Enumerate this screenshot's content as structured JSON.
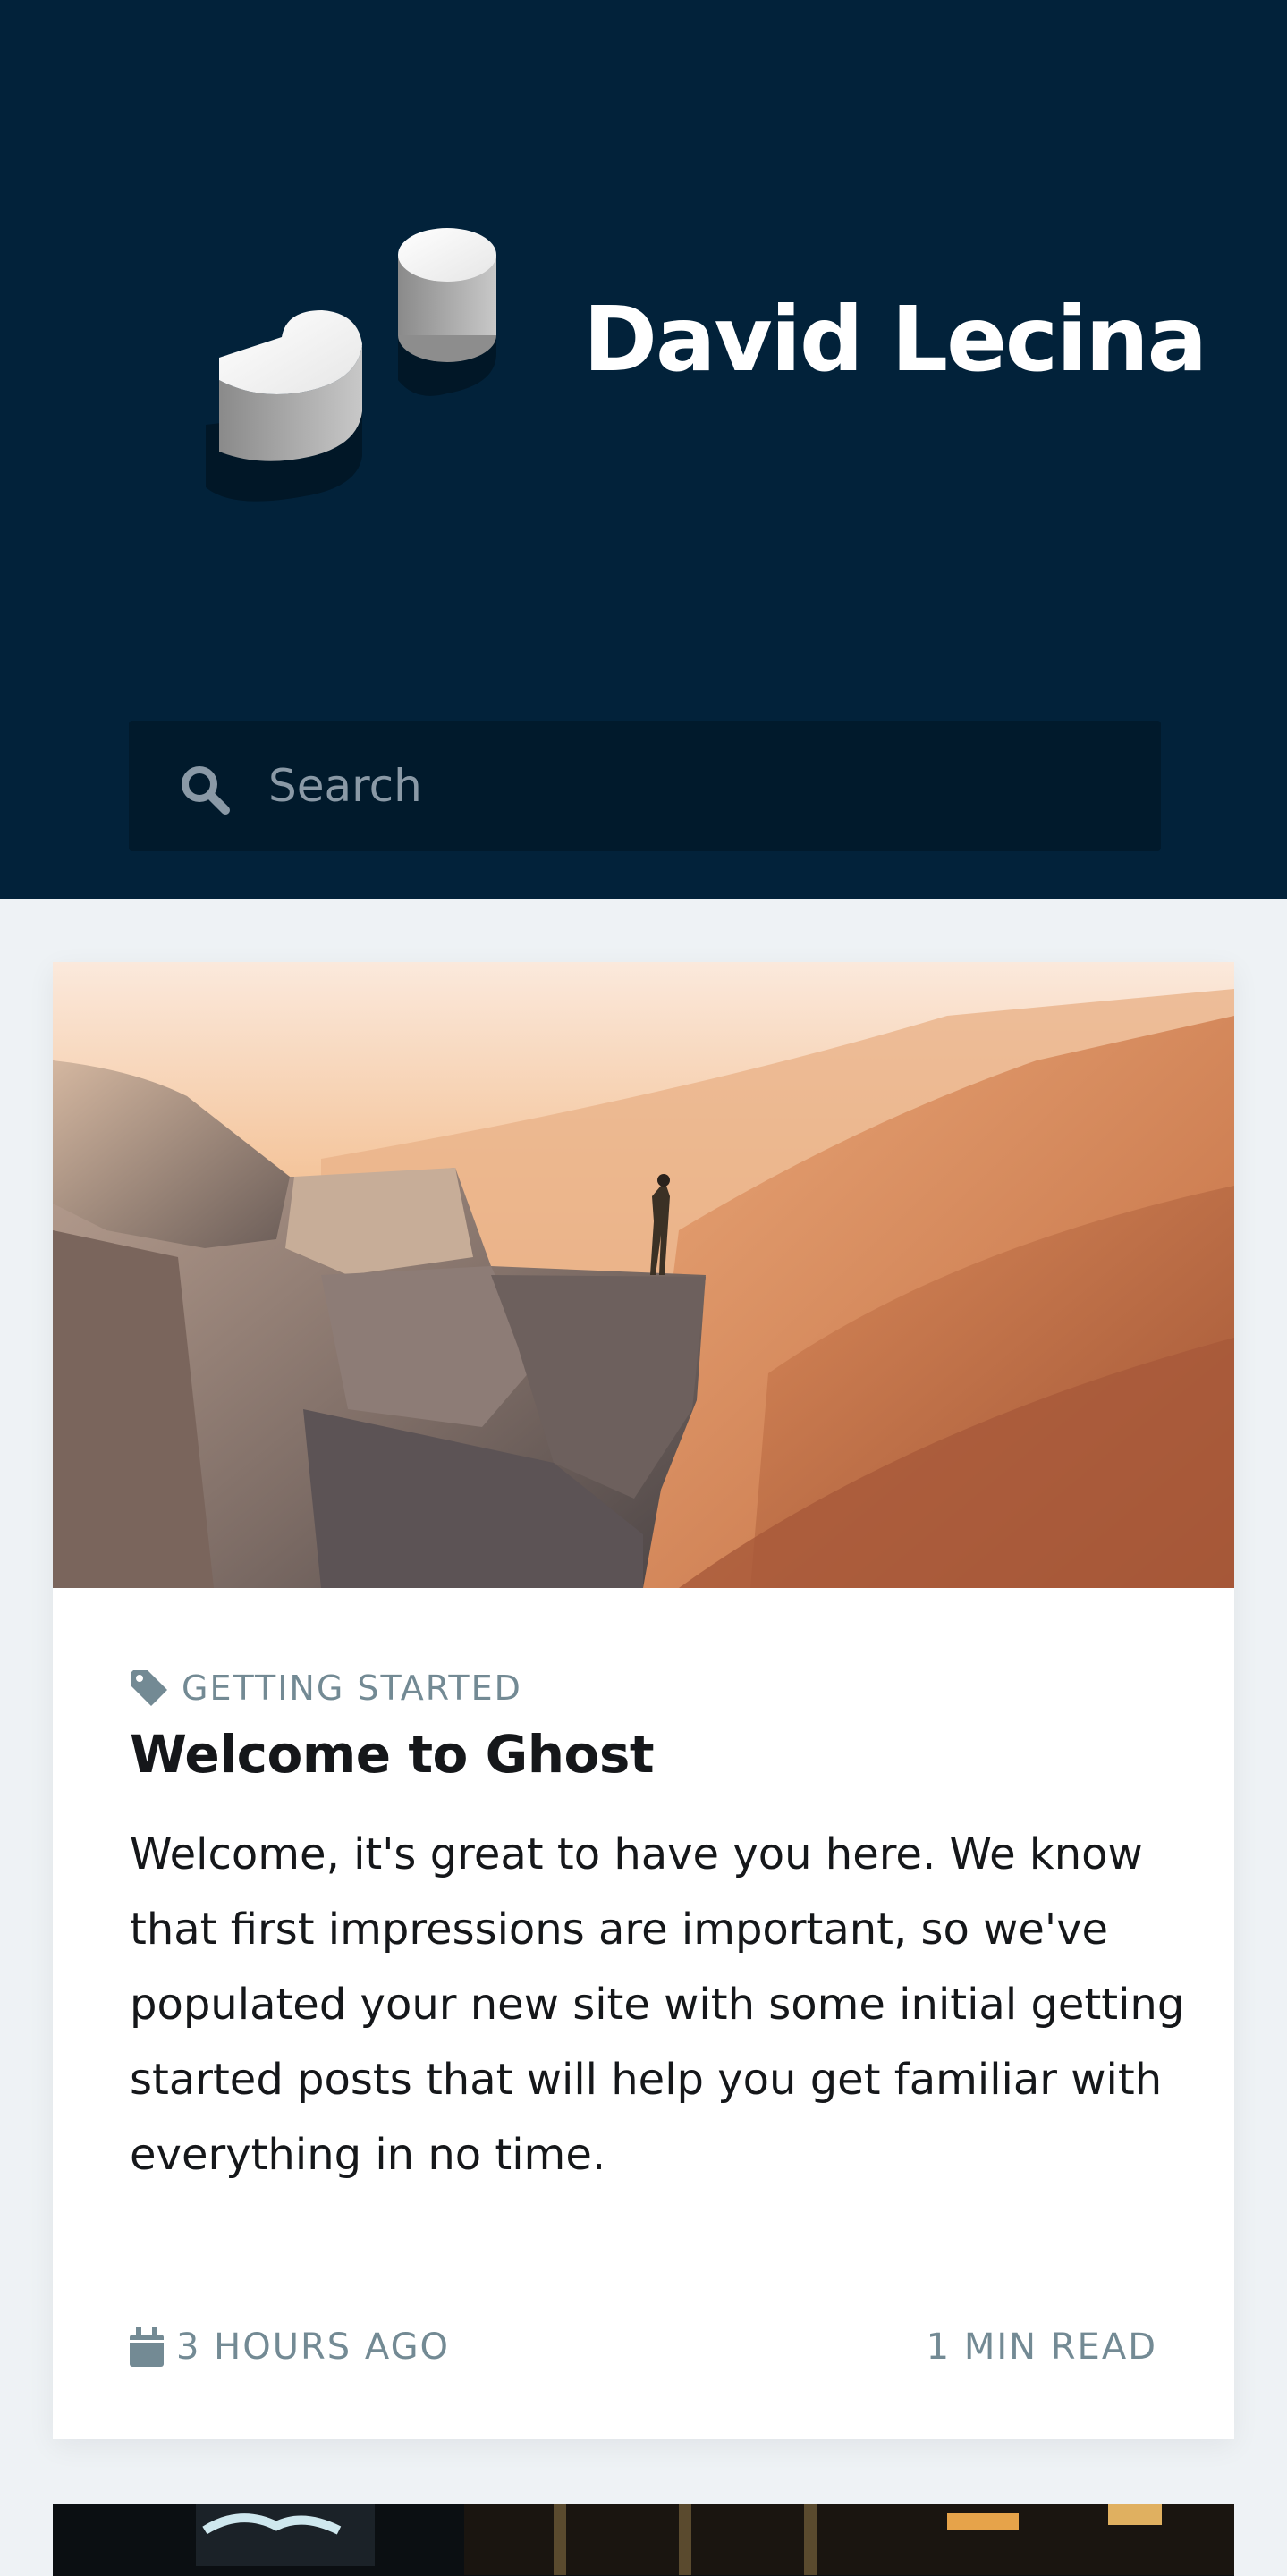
{
  "site": {
    "title": "David Lecina",
    "logo_icon": "isometric-shapes-logo"
  },
  "search": {
    "placeholder": "Search",
    "icon": "search-icon"
  },
  "posts": [
    {
      "tag": "GETTING STARTED",
      "title": "Welcome to Ghost",
      "excerpt": "Welcome, it's great to have you here. We know that first impressions are important, so we've populated your new site with some initial getting started posts that will help you get familiar with everything in no time.",
      "date": "3 HOURS AGO",
      "read_time": "1 MIN READ"
    }
  ],
  "colors": {
    "header_bg": "#02223a",
    "search_bg": "#011a2c",
    "page_bg": "#eef2f5",
    "meta_text": "#738a94"
  }
}
